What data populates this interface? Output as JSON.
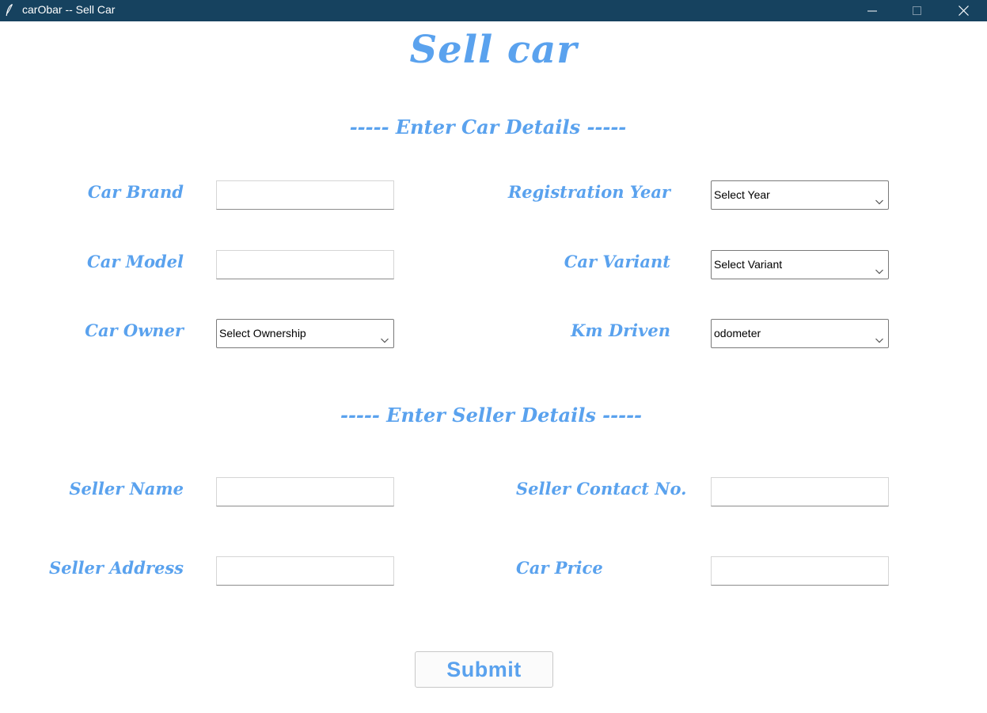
{
  "window": {
    "title": "carObar -- Sell Car"
  },
  "page": {
    "title": "Sell car"
  },
  "car_section": {
    "heading": "----- Enter Car Details -----",
    "car_brand_label": "Car Brand",
    "car_brand_value": "",
    "car_model_label": "Car Model",
    "car_model_value": "",
    "car_owner_label": "Car Owner",
    "car_owner_selected": "Select Ownership",
    "registration_year_label": "Registration Year",
    "registration_year_selected": "Select Year",
    "car_variant_label": "Car Variant",
    "car_variant_selected": "Select Variant",
    "km_driven_label": "Km Driven",
    "km_driven_selected": "odometer"
  },
  "seller_section": {
    "heading": "----- Enter Seller Details -----",
    "seller_name_label": "Seller Name",
    "seller_name_value": "",
    "seller_address_label": "Seller Address",
    "seller_address_value": "",
    "seller_contact_label": "Seller Contact No.",
    "seller_contact_value": "",
    "car_price_label": "Car Price",
    "car_price_value": ""
  },
  "actions": {
    "submit_label": "Submit"
  },
  "colors": {
    "accent": "#5aa2ee",
    "titlebar": "#16425f"
  },
  "icons": {
    "app": "feather-icon",
    "minimize": "minimize-icon",
    "maximize": "maximize-icon",
    "close": "close-icon",
    "dropdown": "chevron-down-icon"
  }
}
